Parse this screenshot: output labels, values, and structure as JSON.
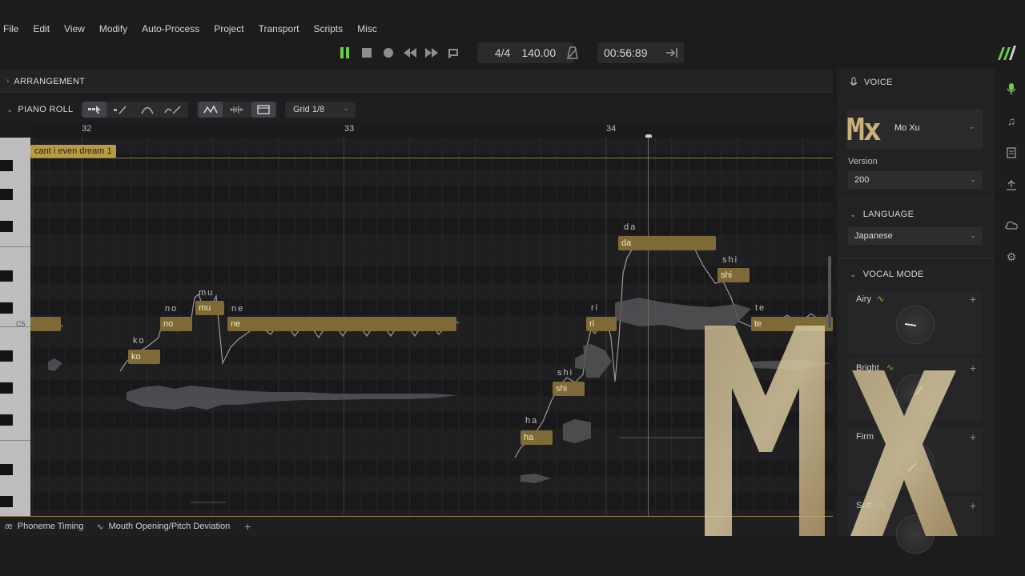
{
  "menu": [
    "File",
    "Edit",
    "View",
    "Modify",
    "Auto-Process",
    "Project",
    "Transport",
    "Scripts",
    "Misc"
  ],
  "transport": {
    "time_signature": "4/4",
    "tempo": "140.00",
    "time": "00:56:89"
  },
  "arrangement": {
    "label": "ARRANGEMENT"
  },
  "piano_roll": {
    "label": "PIANO ROLL",
    "grid": "Grid 1/8",
    "bars": [
      "32",
      "33",
      "34"
    ],
    "clip_name": "cant i even dream 1",
    "key_label": "C5",
    "notes": [
      {
        "text": "ko",
        "lyric": "ko"
      },
      {
        "text": "no",
        "lyric": "no"
      },
      {
        "text": "mu",
        "lyric": "mu"
      },
      {
        "text": "ne",
        "lyric": "ne"
      },
      {
        "text": "ha",
        "lyric": "ha"
      },
      {
        "text": "shi",
        "lyric": "shi"
      },
      {
        "text": "ri",
        "lyric": "ri"
      },
      {
        "text": "da",
        "lyric": "da"
      },
      {
        "text": "shi",
        "lyric": "shi"
      },
      {
        "text": "te",
        "lyric": "te"
      }
    ]
  },
  "bottom_tabs": [
    "Phoneme Timing",
    "Mouth Opening/Pitch Deviation"
  ],
  "voice_panel": {
    "header": "VOICE",
    "voice_name": "Mo Xu",
    "voice_logo": "Mx",
    "version_label": "Version",
    "version": "200",
    "language_header": "LANGUAGE",
    "language": "Japanese",
    "vocal_mode_header": "VOCAL MODE",
    "modes": [
      {
        "label": "Airy"
      },
      {
        "label": "Bright"
      },
      {
        "label": "Firm"
      },
      {
        "label": "Soft"
      }
    ]
  },
  "overlay_logo": "MX",
  "colors": {
    "accent": "#6ccf3f",
    "note_fill": "#7d6a36",
    "clip": "#b89a45"
  }
}
